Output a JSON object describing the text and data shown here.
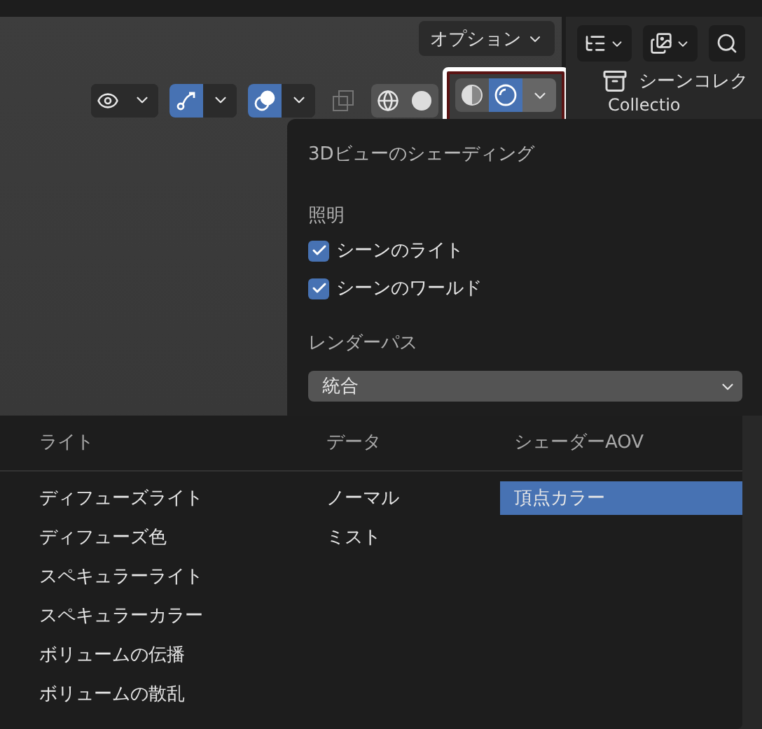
{
  "header": {
    "options_button": "オプション"
  },
  "toolbar": {
    "toggles": [
      {
        "kind": "visibility",
        "active": false
      },
      {
        "kind": "gizmo",
        "active": true
      },
      {
        "kind": "overlay",
        "active": true
      }
    ],
    "xray": {
      "active": false
    },
    "shading_modes": [
      {
        "kind": "wireframe",
        "selected": false
      },
      {
        "kind": "solid",
        "selected": false
      },
      {
        "kind": "material",
        "selected": false
      },
      {
        "kind": "rendered",
        "selected": true
      }
    ]
  },
  "outliner": {
    "title": "シーンコレク",
    "collection": "Collectio"
  },
  "shading_popover": {
    "title": "3Dビューのシェーディング",
    "lighting": {
      "label": "照明",
      "options": [
        {
          "label": "シーンのライト",
          "checked": true
        },
        {
          "label": "シーンのワールド",
          "checked": true
        }
      ]
    },
    "render_pass": {
      "label": "レンダーパス",
      "value": "統合"
    }
  },
  "pass_menu": {
    "columns": [
      {
        "heading": "ライト",
        "items": [
          {
            "label": "ディフューズライト",
            "selected": false
          },
          {
            "label": "ディフューズ色",
            "selected": false
          },
          {
            "label": "スペキュラーライト",
            "selected": false
          },
          {
            "label": "スペキュラーカラー",
            "selected": false
          },
          {
            "label": "ボリュームの伝播",
            "selected": false
          },
          {
            "label": "ボリュームの散乱",
            "selected": false
          }
        ]
      },
      {
        "heading": "データ",
        "items": [
          {
            "label": "ノーマル",
            "selected": false
          },
          {
            "label": "ミスト",
            "selected": false
          }
        ]
      },
      {
        "heading": "シェーダーAOV",
        "items": [
          {
            "label": "頂点カラー",
            "selected": true
          }
        ]
      }
    ]
  }
}
